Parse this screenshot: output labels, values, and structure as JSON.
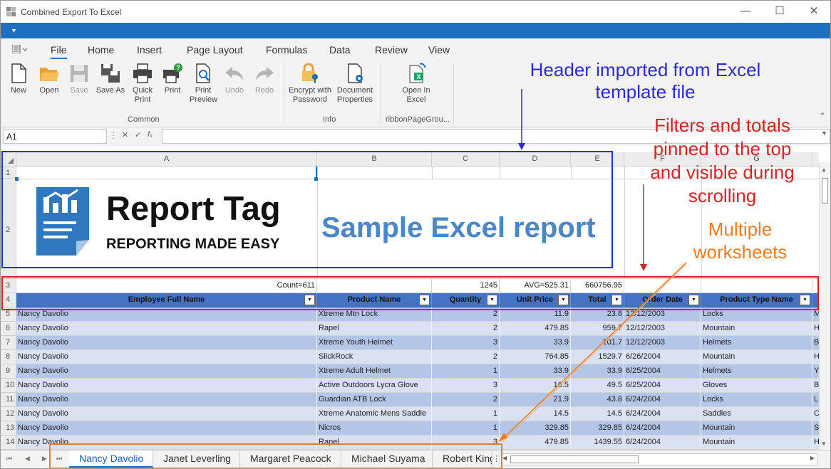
{
  "window": {
    "title": "Combined Export To Excel"
  },
  "menu": {
    "tabs": [
      "File",
      "Home",
      "Insert",
      "Page Layout",
      "Formulas",
      "Data",
      "Review",
      "View"
    ]
  },
  "ribbon": {
    "new": "New",
    "open": "Open",
    "save": "Save",
    "save_as": "Save As",
    "quick_print_1": "Quick",
    "quick_print_2": "Print",
    "print": "Print",
    "print_preview_1": "Print",
    "print_preview_2": "Preview",
    "undo": "Undo",
    "redo": "Redo",
    "encrypt_1": "Encrypt with",
    "encrypt_2": "Password",
    "doc_props_1": "Document",
    "doc_props_2": "Properties",
    "open_excel_1": "Open In",
    "open_excel_2": "Excel",
    "group_common": "Common",
    "group_info": "Info",
    "group_page": "ribbonPageGrou..."
  },
  "formula_bar": {
    "cell_ref": "A1",
    "formula": ""
  },
  "sheet": {
    "columns": [
      "A",
      "B",
      "C",
      "D",
      "E",
      "F",
      "G"
    ],
    "logo": {
      "title": "Report Tag",
      "subtitle": "REPORTING MADE EASY"
    },
    "sample_title": "Sample Excel report",
    "totals": {
      "count": "Count=611",
      "quantity": "1245",
      "avg": "AVG=525.31",
      "total": "660756.95"
    },
    "headers": [
      "Employee Full Name",
      "Product Name",
      "Quantity",
      "Unit Price",
      "Total",
      "Order Date",
      "Product Type Name"
    ],
    "rows": [
      {
        "num": "5",
        "name": "Nancy Davolio",
        "product": "Xtreme Mtn Lock",
        "qty": "2",
        "price": "11.9",
        "total": "23.8",
        "date": "12/12/2003",
        "type": "Locks",
        "extra": "M"
      },
      {
        "num": "6",
        "name": "Nancy Davolio",
        "product": "Rapel",
        "qty": "2",
        "price": "479.85",
        "total": "959.7",
        "date": "12/12/2003",
        "type": "Mountain",
        "extra": "H"
      },
      {
        "num": "7",
        "name": "Nancy Davolio",
        "product": "Xtreme Youth Helmet",
        "qty": "3",
        "price": "33.9",
        "total": "101.7",
        "date": "12/12/2003",
        "type": "Helmets",
        "extra": "B"
      },
      {
        "num": "8",
        "name": "Nancy Davolio",
        "product": "SlickRock",
        "qty": "2",
        "price": "764.85",
        "total": "1529.7",
        "date": "6/26/2004",
        "type": "Mountain",
        "extra": "H"
      },
      {
        "num": "9",
        "name": "Nancy Davolio",
        "product": "Xtreme Adult Helmet",
        "qty": "1",
        "price": "33.9",
        "total": "33.9",
        "date": "6/25/2004",
        "type": "Helmets",
        "extra": "Y"
      },
      {
        "num": "10",
        "name": "Nancy Davolio",
        "product": "Active Outdoors Lycra Glove",
        "qty": "3",
        "price": "16.5",
        "total": "49.5",
        "date": "6/25/2004",
        "type": "Gloves",
        "extra": "B"
      },
      {
        "num": "11",
        "name": "Nancy Davolio",
        "product": "Guardian ATB Lock",
        "qty": "2",
        "price": "21.9",
        "total": "43.8",
        "date": "6/24/2004",
        "type": "Locks",
        "extra": "L"
      },
      {
        "num": "12",
        "name": "Nancy Davolio",
        "product": "Xtreme Anatomic Mens Saddle",
        "qty": "1",
        "price": "14.5",
        "total": "14.5",
        "date": "6/24/2004",
        "type": "Saddles",
        "extra": "C"
      },
      {
        "num": "13",
        "name": "Nancy Davolio",
        "product": "Nicros",
        "qty": "1",
        "price": "329.85",
        "total": "329.85",
        "date": "6/24/2004",
        "type": "Mountain",
        "extra": "S"
      },
      {
        "num": "14",
        "name": "Nancy Davolio",
        "product": "Rapel",
        "qty": "3",
        "price": "479.85",
        "total": "1439.55",
        "date": "6/24/2004",
        "type": "Mountain",
        "extra": "H"
      }
    ]
  },
  "sheets": [
    "Nancy Davolio",
    "Janet Leverling",
    "Margaret Peacock",
    "Michael Suyama",
    "Robert King"
  ],
  "annotations": {
    "header_1": "Header imported from Excel",
    "header_2": "template file",
    "filters_1": "Filters and totals",
    "filters_2": "pinned to the top",
    "filters_3": "and visible during",
    "filters_4": "scrolling",
    "multi_1": "Multiple",
    "multi_2": "worksheets"
  },
  "colors": {
    "accent": "#1f6fc0",
    "header_row": "#4472c4",
    "band_dark": "#b4c6e7",
    "band_light": "#d9e1f2",
    "ann_blue": "#2b2bd9",
    "ann_red": "#d62424",
    "ann_orange": "#f07c1e"
  }
}
